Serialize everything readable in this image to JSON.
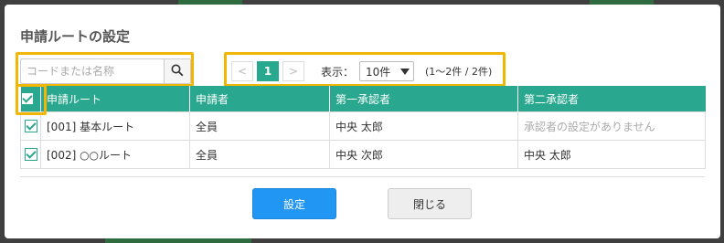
{
  "dialog": {
    "title": "申請ルートの設定"
  },
  "search": {
    "placeholder": "コードまたは名称",
    "icon": "search-icon"
  },
  "pager": {
    "prev_label": "<",
    "current_page": "1",
    "next_label": ">",
    "display_label": "表示：",
    "page_size": "10件",
    "count_text": "(1〜2件 / 2件)"
  },
  "table": {
    "headers": [
      "申請ルート",
      "申請者",
      "第一承認者",
      "第二承認者"
    ],
    "rows": [
      {
        "route": "[001] 基本ルート",
        "applicant": "全員",
        "first": "中央 太郎",
        "second": "承認者の設定がありません",
        "checked": true
      },
      {
        "route": "[002] ○○ルート",
        "applicant": "全員",
        "first": "中央 次郎",
        "second": "中央 太郎",
        "checked": true
      }
    ]
  },
  "buttons": {
    "ok": "設定",
    "close": "閉じる"
  },
  "colors": {
    "accent": "#2aa88f",
    "primary_button": "#2196f3",
    "highlight": "#f2b705"
  }
}
